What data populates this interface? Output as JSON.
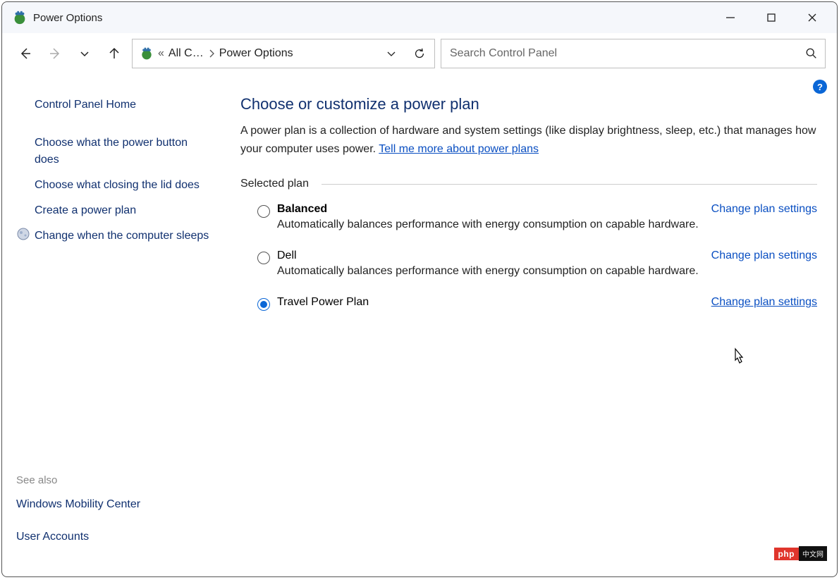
{
  "window": {
    "title": "Power Options"
  },
  "address": {
    "crumb_prefix": "«",
    "crumb1": "All C…",
    "crumb2": "Power Options"
  },
  "search": {
    "placeholder": "Search Control Panel"
  },
  "sidebar": {
    "home": "Control Panel Home",
    "items": [
      "Choose what the power button does",
      "Choose what closing the lid does",
      "Create a power plan",
      "Change when the computer sleeps"
    ],
    "see_also_label": "See also",
    "see_also_links": [
      "Windows Mobility Center",
      "User Accounts"
    ]
  },
  "main": {
    "heading": "Choose or customize a power plan",
    "description_pre": "A power plan is a collection of hardware and system settings (like display brightness, sleep, etc.) that manages how your computer uses power. ",
    "description_link": "Tell me more about power plans",
    "section_label": "Selected plan",
    "change_link_label": "Change plan settings",
    "plans": [
      {
        "name": "Balanced",
        "bold": true,
        "selected": false,
        "desc": "Automatically balances performance with energy consumption on capable hardware."
      },
      {
        "name": "Dell",
        "bold": false,
        "selected": false,
        "desc": "Automatically balances performance with energy consumption on capable hardware."
      },
      {
        "name": "Travel Power Plan",
        "bold": false,
        "selected": true,
        "desc": ""
      }
    ]
  },
  "help_char": "?",
  "footer": {
    "php": "php",
    "cn": "中文网"
  }
}
